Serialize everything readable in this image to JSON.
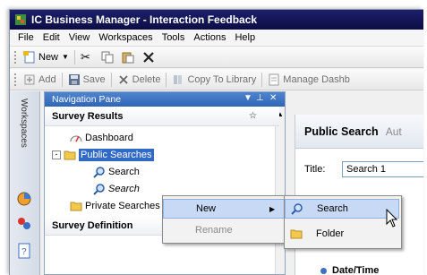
{
  "window": {
    "title": "IC Business Manager - Interaction Feedback"
  },
  "menubar": [
    "File",
    "Edit",
    "View",
    "Workspaces",
    "Tools",
    "Actions",
    "Help"
  ],
  "toolbar1": {
    "new_label": "New"
  },
  "toolbar2": {
    "add": "Add",
    "save": "Save",
    "delete": "Delete",
    "copy_to_library": "Copy To Library",
    "manage_dashboards": "Manage Dashb"
  },
  "sidebar": {
    "workspaces_label": "Workspaces"
  },
  "nav_pane": {
    "title": "Navigation Pane",
    "section_survey_results": "Survey Results",
    "items": {
      "dashboard": "Dashboard",
      "public_searches": "Public Searches",
      "search1": "Search",
      "search2": "Search",
      "private_searches": "Private Searches"
    },
    "section_survey_definition": "Survey Definition"
  },
  "main": {
    "tab_title": "Public Search",
    "tab_extra": "Aut",
    "title_label": "Title:",
    "title_value": "Search 1",
    "row_label": "Date/Time"
  },
  "context_menu": {
    "new": "New",
    "rename": "Rename"
  },
  "submenu": {
    "search": "Search",
    "folder": "Folder"
  },
  "colors": {
    "title_bar": "#0c0d44",
    "nav_header": "#2f65b5",
    "selection": "#316ac5",
    "menu_highlight": "#c7d9f5"
  }
}
